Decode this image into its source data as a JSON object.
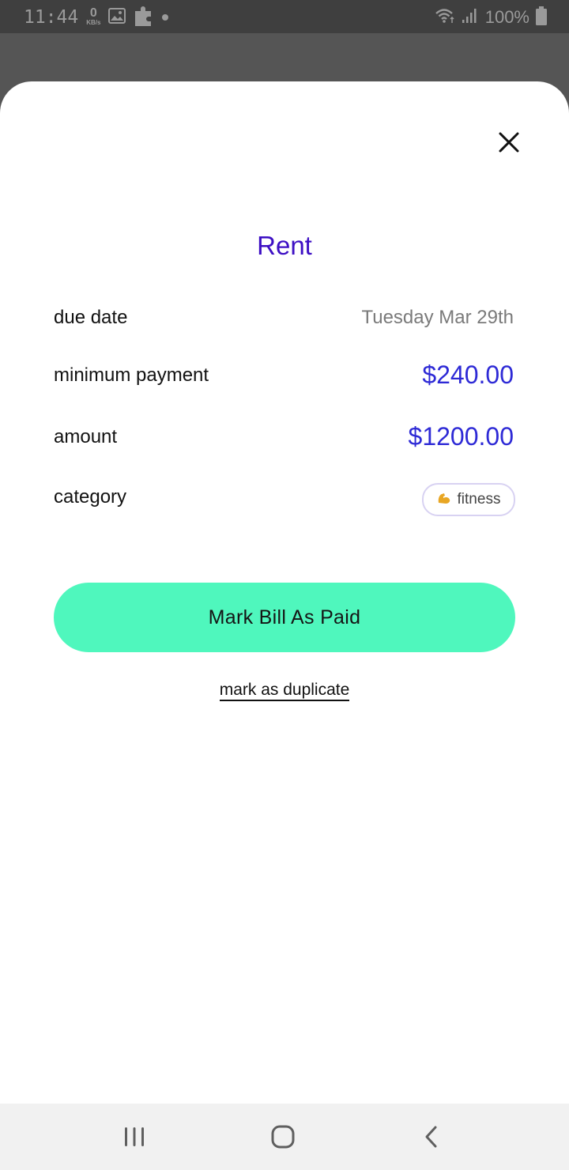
{
  "status_bar": {
    "time": "11:44",
    "net_speed_value": "0",
    "net_speed_unit": "KB/s",
    "battery": "100%"
  },
  "sheet": {
    "title": "Rent",
    "rows": {
      "due_date": {
        "label": "due date",
        "value": "Tuesday Mar 29th"
      },
      "minimum_payment": {
        "label": "minimum payment",
        "value": "$240.00"
      },
      "amount": {
        "label": "amount",
        "value": "$1200.00"
      },
      "category": {
        "label": "category",
        "value": "fitness",
        "icon": "flexed-biceps-icon"
      }
    },
    "primary_button_label": "Mark Bill As Paid",
    "secondary_link_label": "mark as duplicate"
  },
  "colors": {
    "title": "#3d0fc4",
    "money": "#2e2ad6",
    "primary_button": "#4ff7bd",
    "chip_border": "#d8d2f2"
  },
  "nav_bar": {
    "icons": [
      "recent-apps-icon",
      "home-icon",
      "back-icon"
    ]
  }
}
